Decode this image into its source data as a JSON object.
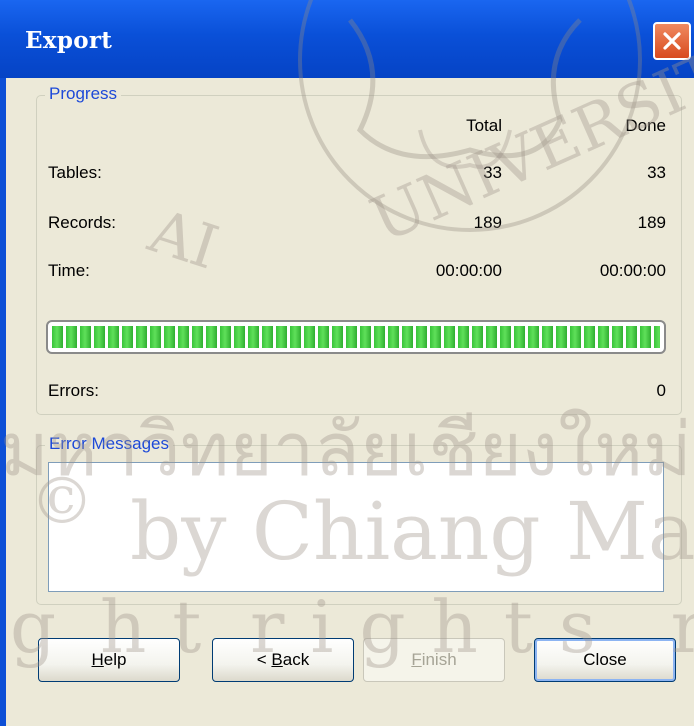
{
  "window": {
    "title": "Export"
  },
  "progress": {
    "legend": "Progress",
    "headers": {
      "total": "Total",
      "done": "Done"
    },
    "rows": [
      {
        "label": "Tables:",
        "total": "33",
        "done": "33"
      },
      {
        "label": "Records:",
        "total": "189",
        "done": "189"
      },
      {
        "label": "Time:",
        "total": "00:00:00",
        "done": "00:00:00"
      }
    ],
    "bar_fraction": 1.0,
    "errors_label": "Errors:",
    "errors_value": "0"
  },
  "error_messages": {
    "legend": "Error Messages"
  },
  "buttons": {
    "help": {
      "mnemonic": "H",
      "rest": "elp"
    },
    "back": {
      "prefix": "< ",
      "mnemonic": "B",
      "rest": "ack"
    },
    "finish": {
      "mnemonic": "F",
      "rest": "inish"
    },
    "close": {
      "label": "Close"
    }
  },
  "watermark": {
    "university": "UNIVERSITY",
    "line1": "มหาวิทยาลัยเชียงใหม่",
    "line2": "by Chiang Mai University",
    "line3": "rights reserved",
    "copyright": "©",
    "fragment_ai": "AI",
    "fragment_ht": "ht",
    "fragment_g": "g"
  },
  "colors": {
    "titlebar": "#0a50d8",
    "client": "#ece9d8",
    "legend": "#1d49d8",
    "progress": "#39c33a",
    "close_button": "#d84a1e"
  }
}
